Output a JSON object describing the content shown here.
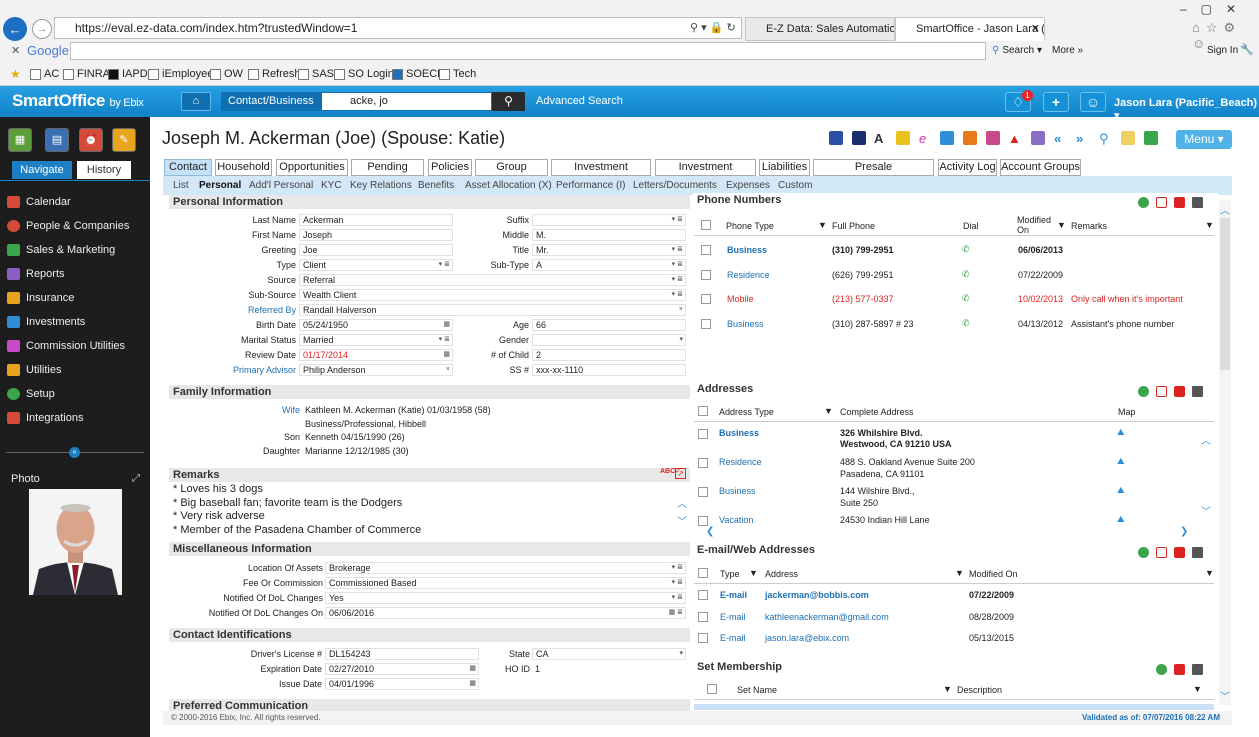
{
  "browser": {
    "url": "https://eval.ez-data.com/index.htm?trustedWindow=1",
    "tabs": [
      "E-Z Data: Sales Automation Sy...",
      "SmartOffice - Jason Lara (P..."
    ],
    "google_label": "Google",
    "search_label": "Search",
    "more_label": "More »",
    "signin_label": "Sign In",
    "favorites": [
      "AC",
      "FINRA",
      "IAPD",
      "iEmployee",
      "OW",
      "Refresh",
      "SAS",
      "SO Login",
      "SOECP",
      "Tech"
    ]
  },
  "header": {
    "logo": "SmartOffice",
    "logo_by": "by Ebix",
    "search_category": "Contact/Business",
    "search_value": "acke, jo",
    "advanced_search": "Advanced Search",
    "notification_count": "1",
    "user": "Jason Lara (Pacific_Beach)"
  },
  "sidebar": {
    "tab_navigate": "Navigate",
    "tab_history": "History",
    "items": [
      "Calendar",
      "People & Companies",
      "Sales & Marketing",
      "Reports",
      "Insurance",
      "Investments",
      "Commission Utilities",
      "Utilities",
      "Setup",
      "Integrations"
    ],
    "photo_label": "Photo"
  },
  "contact": {
    "title": "Joseph M. Ackerman (Joe) (Spouse: Katie)",
    "menu_label": "Menu",
    "main_tabs": [
      "Contact",
      "Household",
      "Opportunities",
      "Pending Cases",
      "Policies",
      "Group Policies",
      "Investment Accounts",
      "Investment Positions",
      "Liabilities",
      "Presale Activity/Proposals",
      "Activity Log",
      "Account Groups"
    ],
    "sub_tabs": [
      "List",
      "Personal",
      "Add'l Personal",
      "KYC",
      "Key Relations",
      "Benefits",
      "Asset Allocation (X)",
      "Performance (I)",
      "Letters/Documents",
      "Expenses",
      "Custom"
    ]
  },
  "personal": {
    "header": "Personal Information",
    "last_name_label": "Last Name",
    "last_name": "Ackerman",
    "first_name_label": "First Name",
    "first_name": "Joseph",
    "greeting_label": "Greeting",
    "greeting": "Joe",
    "type_label": "Type",
    "type": "Client",
    "source_label": "Source",
    "source": "Referral",
    "subsource_label": "Sub-Source",
    "subsource": "Wealth Client",
    "referred_by_label": "Referred By",
    "referred_by": "Randall Halverson",
    "birth_date_label": "Birth Date",
    "birth_date": "05/24/1950",
    "marital_label": "Marital Status",
    "marital": "Married",
    "review_label": "Review Date",
    "review": "01/17/2014",
    "advisor_label": "Primary Advisor",
    "advisor": "Philip Anderson",
    "suffix_label": "Suffix",
    "suffix": "",
    "middle_label": "Middle",
    "middle": "M.",
    "title_label": "Title",
    "title": "Mr.",
    "subtype_label": "Sub-Type",
    "subtype": "A",
    "age_label": "Age",
    "age": "66",
    "gender_label": "Gender",
    "gender": "",
    "children_label": "# of Child",
    "children": "2",
    "ssn_label": "SS #",
    "ssn": "xxx-xx-1110"
  },
  "family": {
    "header": "Family Information",
    "wife_label": "Wife",
    "wife": "Kathleen M. Ackerman  (Katie) 01/03/1958 (58)",
    "wife_occupation": "Business/Professional, Hibbell",
    "son_label": "Son",
    "son": "Kenneth 04/15/1990 (26)",
    "daughter_label": "Daughter",
    "daughter": "Marianne 12/12/1985 (30)"
  },
  "remarks": {
    "header": "Remarks",
    "lines": [
      "* Loves his 3 dogs",
      "* Big baseball fan; favorite team is the Dodgers",
      "* Very risk adverse",
      "* Member of the Pasadena Chamber of Commerce"
    ]
  },
  "misc": {
    "header": "Miscellaneous Information",
    "location_label": "Location Of Assets",
    "location": "Brokerage",
    "fee_label": "Fee Or Commission",
    "fee": "Commissioned Based",
    "dol_label": "Notified Of DoL Changes",
    "dol": "Yes",
    "dol_on_label": "Notified Of DoL Changes On",
    "dol_on": "06/06/2016"
  },
  "ids": {
    "header": "Contact Identifications",
    "dl_label": "Driver's License #",
    "dl": "DL154243",
    "exp_label": "Expiration Date",
    "exp": "02/27/2010",
    "issue_label": "Issue Date",
    "issue": "04/01/1996",
    "state_label": "State",
    "state": "CA",
    "hoid_label": "HO ID",
    "hoid": "1"
  },
  "preferred": {
    "header": "Preferred Communication"
  },
  "phones": {
    "header": "Phone Numbers",
    "cols": [
      "Phone Type",
      "Full Phone",
      "Dial",
      "Modified On",
      "Remarks"
    ],
    "rows": [
      {
        "type": "Business",
        "phone": "(310) 799-2951",
        "modified": "06/06/2013",
        "remarks": ""
      },
      {
        "type": "Residence",
        "phone": "(626) 799-2951",
        "modified": "07/22/2009",
        "remarks": ""
      },
      {
        "type": "Mobile",
        "phone": "(213) 577-0337",
        "modified": "10/02/2013",
        "remarks": "Only call when it's important"
      },
      {
        "type": "Business",
        "phone": "(310) 287-5897 # 23",
        "modified": "04/13/2012",
        "remarks": "Assistant's phone number"
      }
    ]
  },
  "addresses": {
    "header": "Addresses",
    "cols": [
      "Address Type",
      "Complete Address",
      "Map"
    ],
    "rows": [
      {
        "type": "Business",
        "line1": "326 Whilshire Blvd.",
        "line2": "Westwood, CA 91210 USA"
      },
      {
        "type": "Residence",
        "line1": "488 S. Oakland Avenue Suite 200",
        "line2": "Pasadena, CA 91101"
      },
      {
        "type": "Business",
        "line1": "144 Wilshire Blvd.,",
        "line2": "Suite 250"
      },
      {
        "type": "Vacation",
        "line1": "24530 Indian Hill Lane",
        "line2": ""
      }
    ]
  },
  "emails": {
    "header": "E-mail/Web Addresses",
    "cols": [
      "Type",
      "Address",
      "Modified On"
    ],
    "rows": [
      {
        "type": "E-mail",
        "address": "jackerman@bobbis.com",
        "modified": "07/22/2009"
      },
      {
        "type": "E-mail",
        "address": "kathleenackerman@gmail.com",
        "modified": "08/28/2009"
      },
      {
        "type": "E-mail",
        "address": "jason.lara@ebix.com",
        "modified": "05/13/2015"
      }
    ]
  },
  "sets": {
    "header": "Set Membership",
    "cols": [
      "Set Name",
      "Description"
    ]
  },
  "footer": {
    "copyright": "© 2000-2016 Ebix, Inc. All rights reserved.",
    "validated": "Validated as of: 07/07/2016 08:22 AM"
  }
}
